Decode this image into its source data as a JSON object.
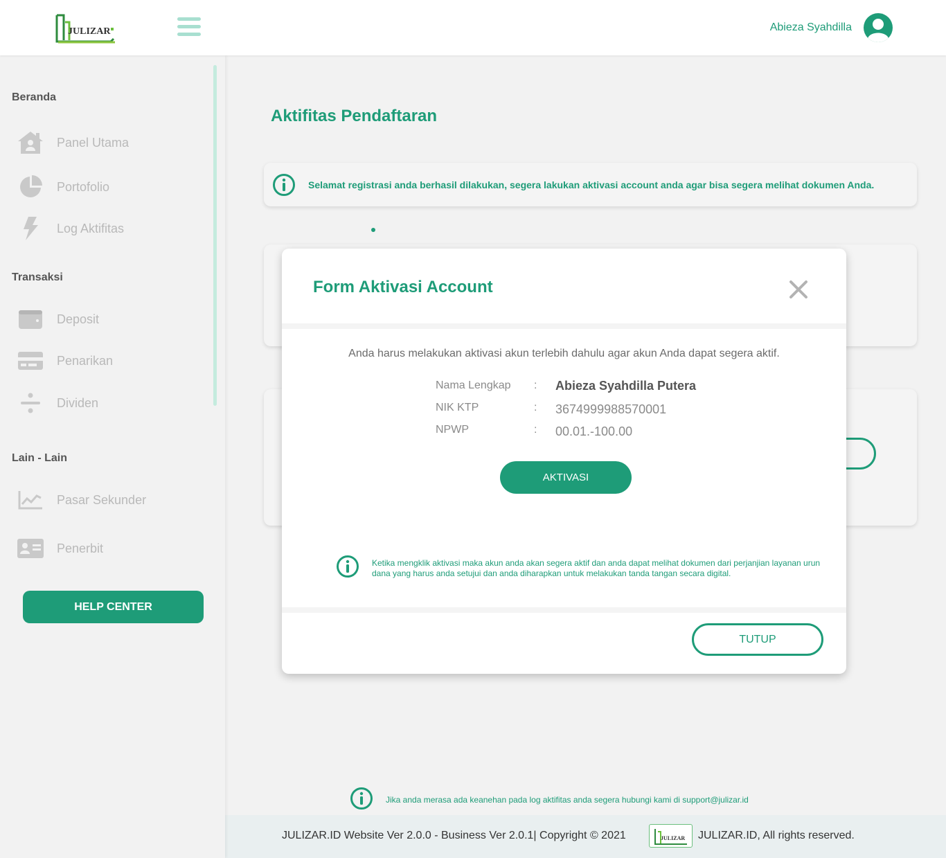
{
  "header": {
    "logo_text": "JULIZAR",
    "user_name": "Abieza Syahdilla"
  },
  "sidebar": {
    "sections": [
      {
        "title": "Beranda",
        "items": [
          {
            "label": "Panel Utama",
            "icon": "home-icon"
          },
          {
            "label": "Portofolio",
            "icon": "pie-chart-icon"
          },
          {
            "label": "Log Aktifitas",
            "icon": "lightning-icon"
          }
        ]
      },
      {
        "title": "Transaksi",
        "items": [
          {
            "label": "Deposit",
            "icon": "wallet-icon"
          },
          {
            "label": "Penarikan",
            "icon": "card-icon"
          },
          {
            "label": "Dividen",
            "icon": "divide-icon"
          }
        ]
      },
      {
        "title": "Lain - Lain",
        "items": [
          {
            "label": "Pasar Sekunder",
            "icon": "trend-chart-icon"
          },
          {
            "label": "Penerbit",
            "icon": "id-card-icon"
          }
        ]
      }
    ],
    "help_center": "HELP CENTER"
  },
  "main": {
    "title": "Aktifitas Pendaftaran",
    "info_message": "Selamat registrasi anda berhasil dilakukan, segera lakukan aktivasi account anda agar bisa segera melihat dokumen Anda."
  },
  "modal": {
    "title": "Form Aktivasi Account",
    "description": "Anda harus melakukan aktivasi akun terlebih dahulu agar akun Anda dapat segera aktif.",
    "fields": [
      {
        "label": "Nama Lengkap",
        "sep": ":",
        "value": "Abieza Syahdilla Putera"
      },
      {
        "label": "NIK KTP",
        "sep": ":",
        "value": "3674999988570001"
      },
      {
        "label": "NPWP",
        "sep": ":",
        "value": "00.01.-100.00"
      }
    ],
    "aktivasi_label": "AKTIVASI",
    "note": "Ketika mengklik aktivasi maka akun anda akan segera aktif dan anda dapat melihat dokumen dari perjanjian layanan urun dana yang harus anda setujui dan anda diharapkan untuk melakukan tanda tangan secara digital.",
    "tutup_label": "TUTUP"
  },
  "footer": {
    "note": "Jika anda merasa ada keanehan pada log aktifitas anda segera hubungi kami di support@julizar.id",
    "version_text": "JULIZAR.ID Website Ver 2.0.0 - Business Ver 2.0.1| Copyright © 2021",
    "rights_text": "JULIZAR.ID, All rights reserved.",
    "logo_text": "JULIZAR"
  },
  "colors": {
    "brand_green": "#1e9c78",
    "light_green": "#a8dfd0",
    "background": "#f2f2f2"
  }
}
